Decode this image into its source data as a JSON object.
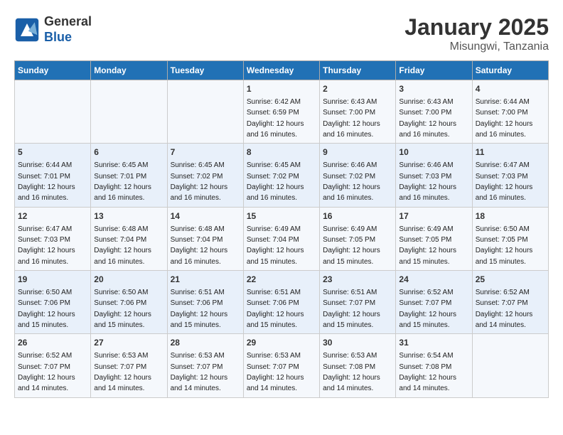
{
  "header": {
    "logo_line1": "General",
    "logo_line2": "Blue",
    "title": "January 2025",
    "subtitle": "Misungwi, Tanzania"
  },
  "weekdays": [
    "Sunday",
    "Monday",
    "Tuesday",
    "Wednesday",
    "Thursday",
    "Friday",
    "Saturday"
  ],
  "weeks": [
    [
      {
        "day": "",
        "info": ""
      },
      {
        "day": "",
        "info": ""
      },
      {
        "day": "",
        "info": ""
      },
      {
        "day": "1",
        "info": "Sunrise: 6:42 AM\nSunset: 6:59 PM\nDaylight: 12 hours\nand 16 minutes."
      },
      {
        "day": "2",
        "info": "Sunrise: 6:43 AM\nSunset: 7:00 PM\nDaylight: 12 hours\nand 16 minutes."
      },
      {
        "day": "3",
        "info": "Sunrise: 6:43 AM\nSunset: 7:00 PM\nDaylight: 12 hours\nand 16 minutes."
      },
      {
        "day": "4",
        "info": "Sunrise: 6:44 AM\nSunset: 7:00 PM\nDaylight: 12 hours\nand 16 minutes."
      }
    ],
    [
      {
        "day": "5",
        "info": "Sunrise: 6:44 AM\nSunset: 7:01 PM\nDaylight: 12 hours\nand 16 minutes."
      },
      {
        "day": "6",
        "info": "Sunrise: 6:45 AM\nSunset: 7:01 PM\nDaylight: 12 hours\nand 16 minutes."
      },
      {
        "day": "7",
        "info": "Sunrise: 6:45 AM\nSunset: 7:02 PM\nDaylight: 12 hours\nand 16 minutes."
      },
      {
        "day": "8",
        "info": "Sunrise: 6:45 AM\nSunset: 7:02 PM\nDaylight: 12 hours\nand 16 minutes."
      },
      {
        "day": "9",
        "info": "Sunrise: 6:46 AM\nSunset: 7:02 PM\nDaylight: 12 hours\nand 16 minutes."
      },
      {
        "day": "10",
        "info": "Sunrise: 6:46 AM\nSunset: 7:03 PM\nDaylight: 12 hours\nand 16 minutes."
      },
      {
        "day": "11",
        "info": "Sunrise: 6:47 AM\nSunset: 7:03 PM\nDaylight: 12 hours\nand 16 minutes."
      }
    ],
    [
      {
        "day": "12",
        "info": "Sunrise: 6:47 AM\nSunset: 7:03 PM\nDaylight: 12 hours\nand 16 minutes."
      },
      {
        "day": "13",
        "info": "Sunrise: 6:48 AM\nSunset: 7:04 PM\nDaylight: 12 hours\nand 16 minutes."
      },
      {
        "day": "14",
        "info": "Sunrise: 6:48 AM\nSunset: 7:04 PM\nDaylight: 12 hours\nand 16 minutes."
      },
      {
        "day": "15",
        "info": "Sunrise: 6:49 AM\nSunset: 7:04 PM\nDaylight: 12 hours\nand 15 minutes."
      },
      {
        "day": "16",
        "info": "Sunrise: 6:49 AM\nSunset: 7:05 PM\nDaylight: 12 hours\nand 15 minutes."
      },
      {
        "day": "17",
        "info": "Sunrise: 6:49 AM\nSunset: 7:05 PM\nDaylight: 12 hours\nand 15 minutes."
      },
      {
        "day": "18",
        "info": "Sunrise: 6:50 AM\nSunset: 7:05 PM\nDaylight: 12 hours\nand 15 minutes."
      }
    ],
    [
      {
        "day": "19",
        "info": "Sunrise: 6:50 AM\nSunset: 7:06 PM\nDaylight: 12 hours\nand 15 minutes."
      },
      {
        "day": "20",
        "info": "Sunrise: 6:50 AM\nSunset: 7:06 PM\nDaylight: 12 hours\nand 15 minutes."
      },
      {
        "day": "21",
        "info": "Sunrise: 6:51 AM\nSunset: 7:06 PM\nDaylight: 12 hours\nand 15 minutes."
      },
      {
        "day": "22",
        "info": "Sunrise: 6:51 AM\nSunset: 7:06 PM\nDaylight: 12 hours\nand 15 minutes."
      },
      {
        "day": "23",
        "info": "Sunrise: 6:51 AM\nSunset: 7:07 PM\nDaylight: 12 hours\nand 15 minutes."
      },
      {
        "day": "24",
        "info": "Sunrise: 6:52 AM\nSunset: 7:07 PM\nDaylight: 12 hours\nand 15 minutes."
      },
      {
        "day": "25",
        "info": "Sunrise: 6:52 AM\nSunset: 7:07 PM\nDaylight: 12 hours\nand 14 minutes."
      }
    ],
    [
      {
        "day": "26",
        "info": "Sunrise: 6:52 AM\nSunset: 7:07 PM\nDaylight: 12 hours\nand 14 minutes."
      },
      {
        "day": "27",
        "info": "Sunrise: 6:53 AM\nSunset: 7:07 PM\nDaylight: 12 hours\nand 14 minutes."
      },
      {
        "day": "28",
        "info": "Sunrise: 6:53 AM\nSunset: 7:07 PM\nDaylight: 12 hours\nand 14 minutes."
      },
      {
        "day": "29",
        "info": "Sunrise: 6:53 AM\nSunset: 7:07 PM\nDaylight: 12 hours\nand 14 minutes."
      },
      {
        "day": "30",
        "info": "Sunrise: 6:53 AM\nSunset: 7:08 PM\nDaylight: 12 hours\nand 14 minutes."
      },
      {
        "day": "31",
        "info": "Sunrise: 6:54 AM\nSunset: 7:08 PM\nDaylight: 12 hours\nand 14 minutes."
      },
      {
        "day": "",
        "info": ""
      }
    ]
  ]
}
